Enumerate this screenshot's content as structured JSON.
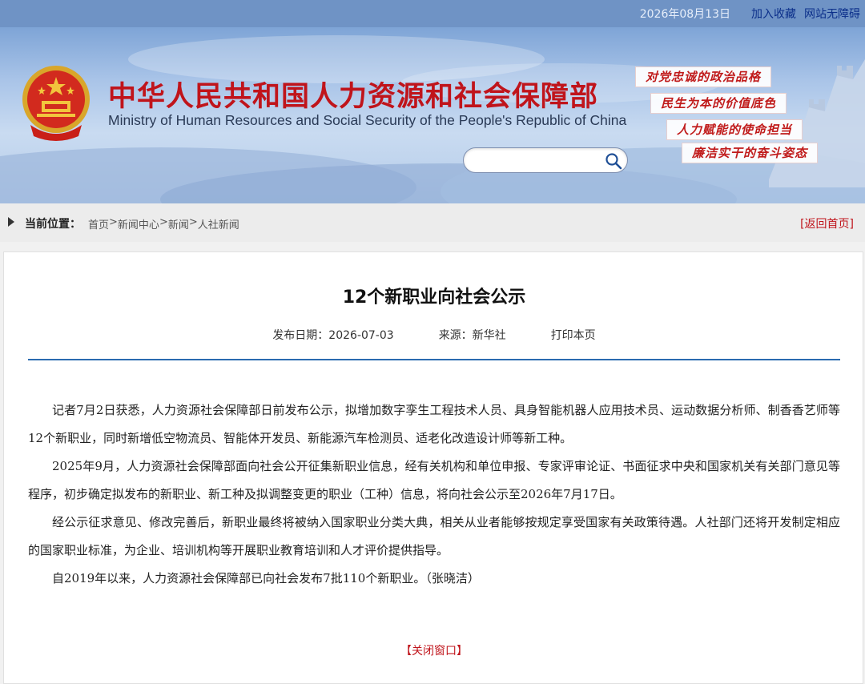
{
  "topbar": {
    "date": "2026年08月13日",
    "links": [
      "加入收藏",
      "网站无障碍"
    ]
  },
  "header": {
    "title_cn": "中华人民共和国人力资源和社会保障部",
    "title_en": "Ministry of Human Resources and Social Security of the People's Republic of China",
    "search": {
      "placeholder": "",
      "value": ""
    },
    "slogans": [
      "对党忠诚的政治品格",
      "民生为本的价值底色",
      "人力赋能的使命担当",
      "廉洁实干的奋斗姿态"
    ],
    "icons": {
      "emblem": "national-emblem-icon",
      "search": "search-icon"
    },
    "colors": {
      "title": "#c0141b",
      "slogan": "#c01a1a",
      "topbar": "#6f93c5"
    }
  },
  "breadcrumb": {
    "label": "当前位置：",
    "items": [
      "首页",
      "新闻中心",
      "新闻",
      "人社新闻"
    ],
    "separator": ">",
    "back": "[返回首页]"
  },
  "article": {
    "title": "12个新职业向社会公示",
    "date": "发布日期：2026-07-03",
    "source": "来源：新华社",
    "print": "打印本页",
    "paragraphs": [
      "记者7月2日获悉，人力资源社会保障部日前发布公示，拟增加数字孪生工程技术人员、具身智能机器人应用技术员、运动数据分析师、制香香艺师等12个新职业，同时新增低空物流员、智能体开发员、新能源汽车检测员、适老化改造设计师等新工种。",
      "2025年9月，人力资源社会保障部面向社会公开征集新职业信息，经有关机构和单位申报、专家评审论证、书面征求中央和国家机关有关部门意见等程序，初步确定拟发布的新职业、新工种及拟调整变更的职业（工种）信息，将向社会公示至2026年7月17日。",
      "经公示征求意见、修改完善后，新职业最终将被纳入国家职业分类大典，相关从业者能够按规定享受国家有关政策待遇。人社部门还将开发制定相应的国家职业标准，为企业、培训机构等开展职业教育培训和人才评价提供指导。",
      "自2019年以来，人力资源社会保障部已向社会发布7批110个新职业。（张晓洁）"
    ],
    "close": "【关闭窗口】"
  }
}
